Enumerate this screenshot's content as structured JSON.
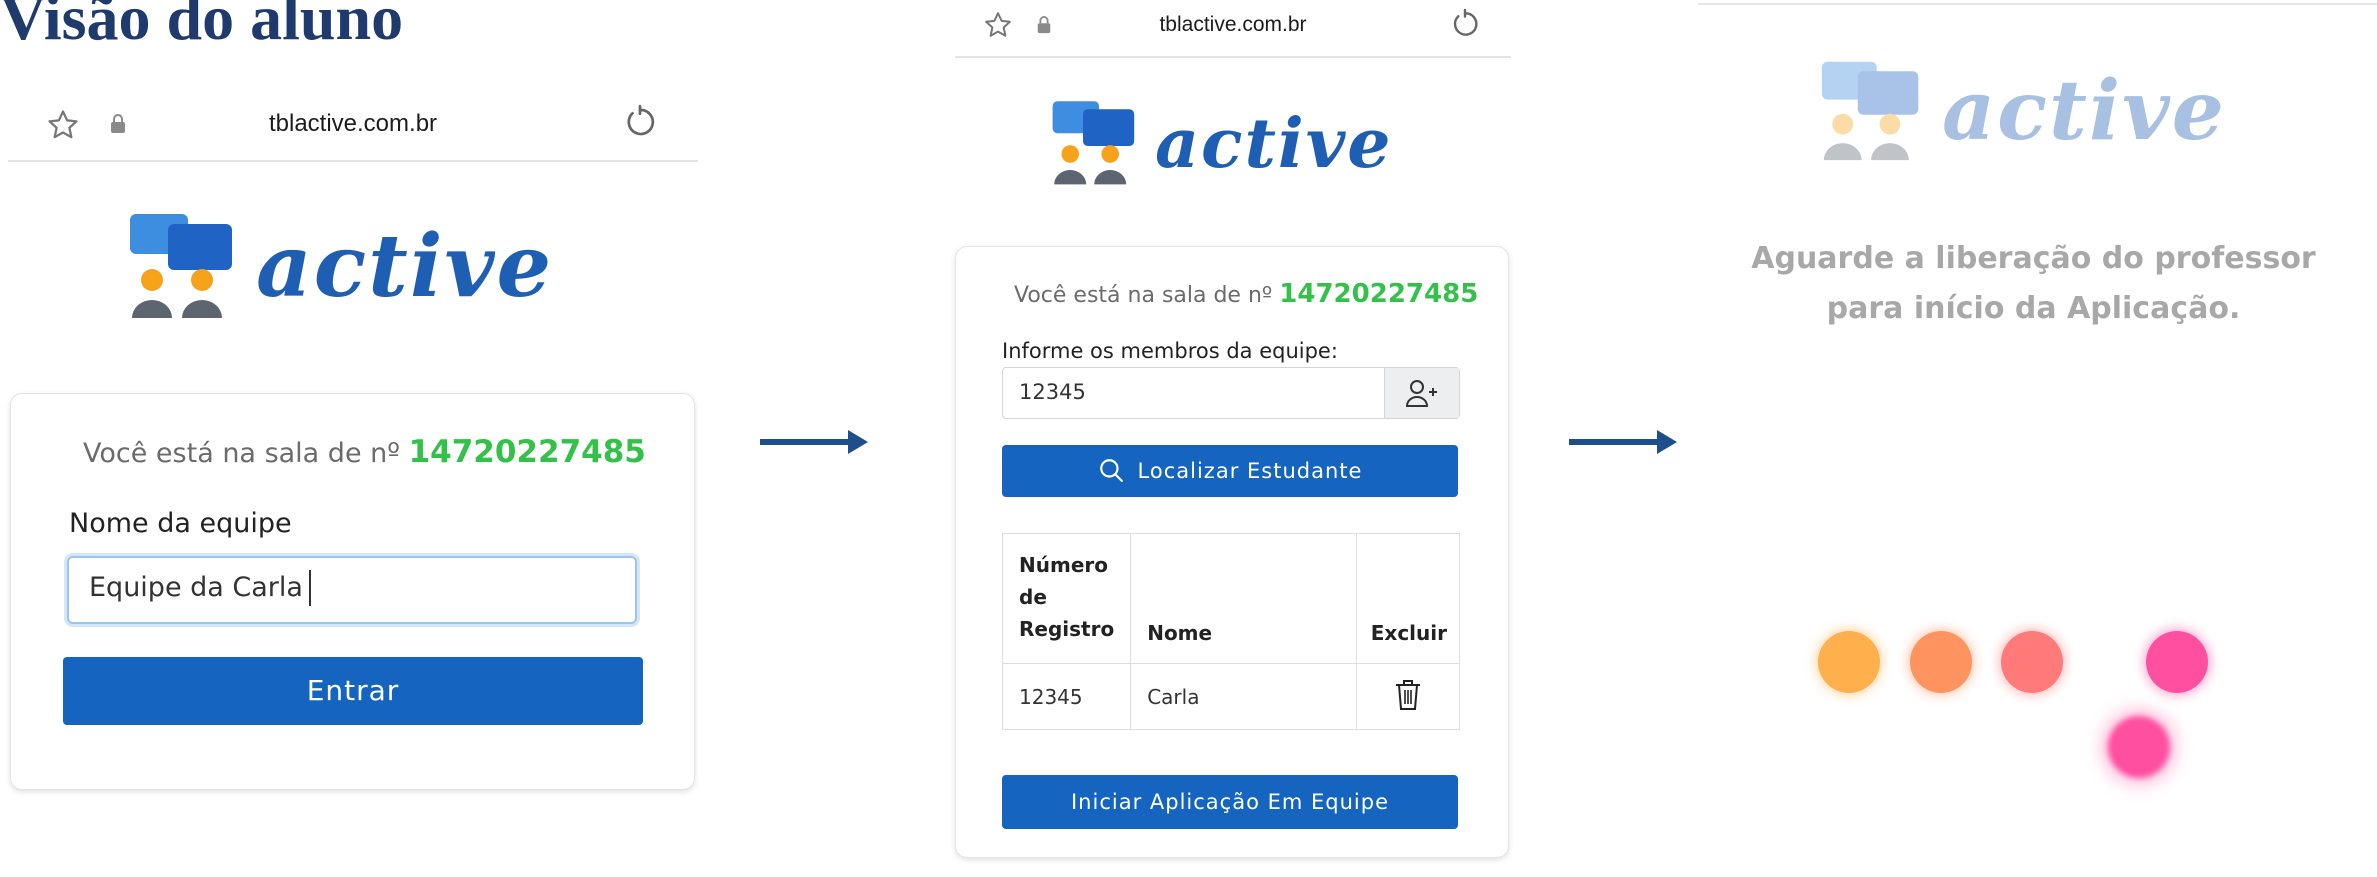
{
  "slide": {
    "title": "Visão do aluno"
  },
  "screen1": {
    "url": "tblactive.com.br",
    "logo_text": "active",
    "room_prefix": "Você está na sala de nº",
    "room_number": "14720227485",
    "team_label": "Nome da equipe",
    "team_value": "Equipe da Carla",
    "enter_button": "Entrar"
  },
  "screen2": {
    "url": "tblactive.com.br",
    "logo_text": "active",
    "room_prefix": "Você está na sala de nº",
    "room_number": "14720227485",
    "members_label": "Informe os membros da equipe:",
    "member_input_value": "12345",
    "search_button": "Localizar Estudante",
    "table": {
      "headers": [
        "Número de Registro",
        "Nome",
        "Excluir"
      ],
      "rows": [
        {
          "registro": "12345",
          "nome": "Carla"
        }
      ]
    },
    "start_button": "Iniciar Aplicação Em Equipe"
  },
  "screen3": {
    "logo_text": "active",
    "waiting_line1": "Aguarde a liberação do professor",
    "waiting_line2": "para início da Aplicação."
  },
  "colors": {
    "brand_blue": "#1565c0",
    "room_number_green": "#33c14a",
    "arrow": "#1f4e8c",
    "loader": [
      "#ffb04d",
      "#ff9460",
      "#ff7a78",
      "#ff4fa0",
      "#ff4fa0"
    ]
  }
}
